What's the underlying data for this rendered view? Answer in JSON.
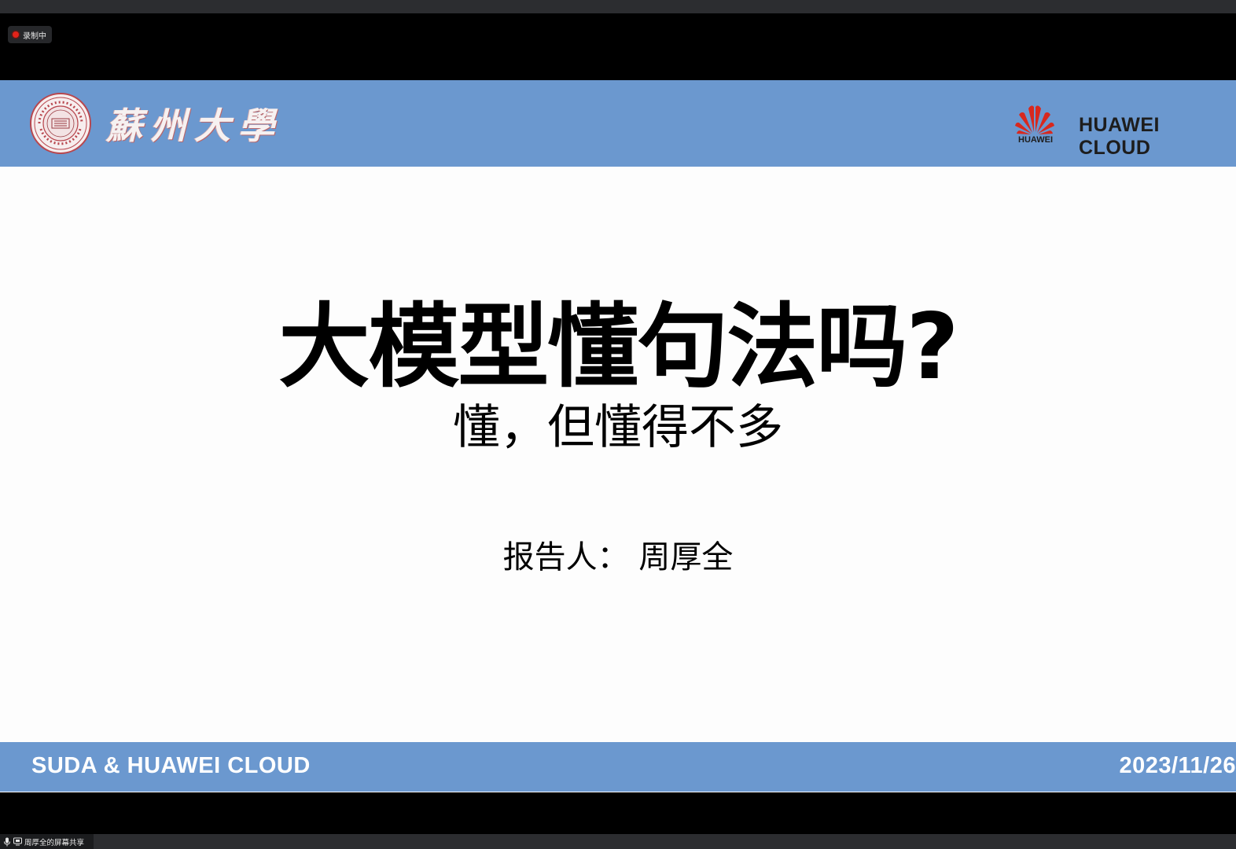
{
  "recording": {
    "label": "录制中",
    "dot_color": "#e2231a"
  },
  "slide": {
    "header": {
      "university_name": "蘇州大學",
      "huawei_logo_text": "HUAWEI",
      "huawei_cloud_text": "HUAWEI CLOUD",
      "bar_color": "#6b98cf"
    },
    "title": "大模型懂句法吗?",
    "subtitle": "懂，但懂得不多",
    "presenter": "报告人：  周厚全",
    "footer": {
      "left_text": "SUDA & HUAWEI CLOUD",
      "date": "2023/11/26",
      "bar_color": "#6b98cf"
    }
  },
  "screen_share": {
    "label": "周厚全的屏幕共享",
    "mic_icon": "microphone-icon",
    "share_icon": "screen-share-icon"
  }
}
